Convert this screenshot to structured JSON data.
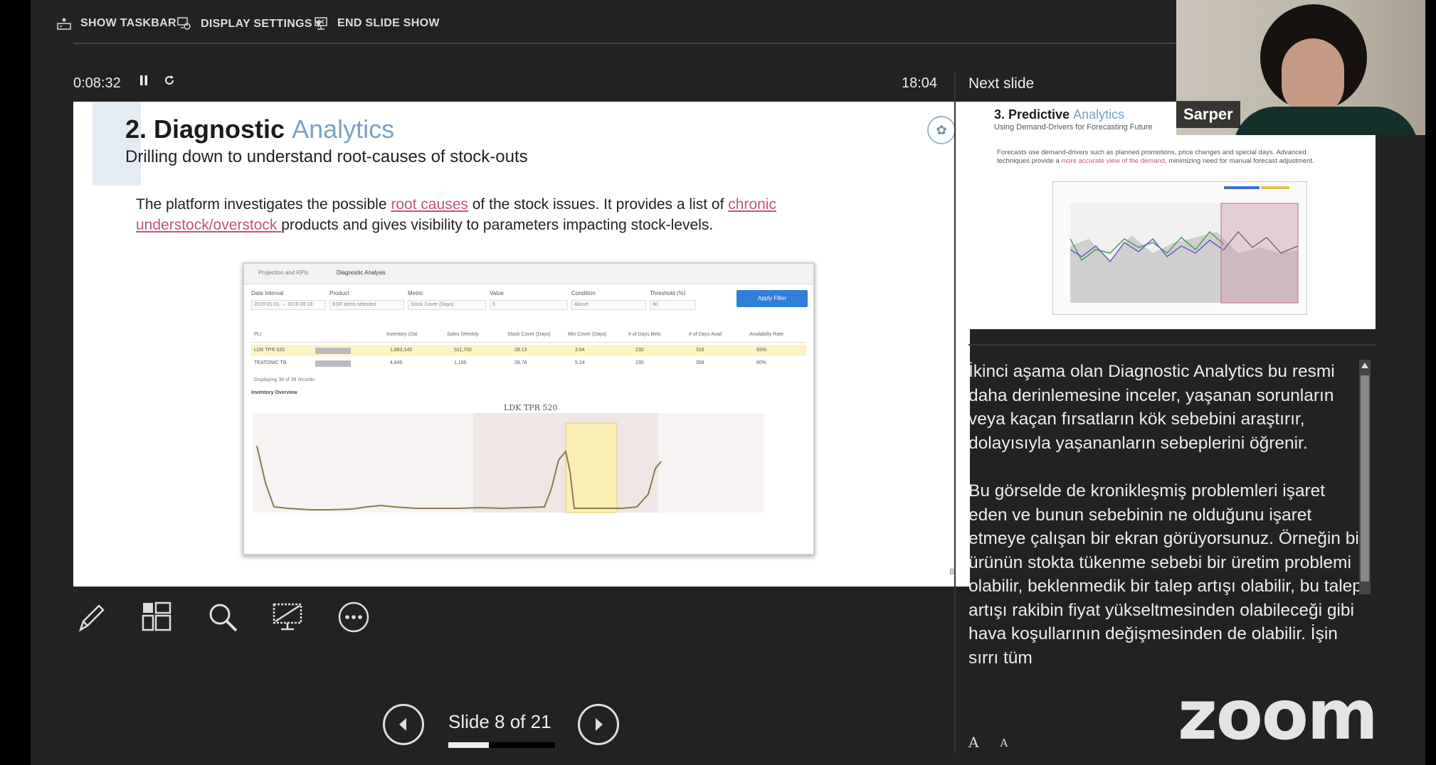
{
  "topbar": {
    "show_taskbar": "SHOW TASKBAR",
    "display_settings": "DISPLAY SETTINGS ▾",
    "end_slide_show": "END SLIDE SHOW"
  },
  "timer": {
    "elapsed": "0:08:32",
    "clock": "18:04"
  },
  "current_slide": {
    "title_main": "2. Diagnostic ",
    "title_highlight": "Analytics",
    "subtitle": "Drilling down to understand root-causes of stock-outs",
    "body_part1": "The platform investigates the possible ",
    "body_link1": "root causes",
    "body_part2": " of the stock issues. It provides a list of ",
    "body_link2": "chronic understock/overstock ",
    "body_part3": "products and gives visibility to parameters impacting stock-levels.",
    "page_number": "8",
    "screenshot": {
      "tab1": "Projection and KPIs",
      "tab2": "Diagnostic Analysis",
      "filter_labels": [
        "Date Interval",
        "Product",
        "Metric",
        "Value",
        "Condition",
        "Threshold (%)"
      ],
      "filter_values": [
        "2019-01-01 → 2019-08-18",
        "EOF items selected",
        "Stock Cover (Days)",
        "5",
        "Above",
        "80"
      ],
      "apply_button": "Apply Filter",
      "columns": [
        "PLI",
        "Inventory (Dai",
        "Sales (Weekly",
        "Stock Cover (Days)",
        "Min Cover (Days)",
        "# of Days Belo",
        "# of Days Avail",
        "Availabilty Rate"
      ],
      "rows": [
        [
          "LDK TPR 520",
          "1,883,145",
          "511,700",
          "28.13",
          "3.84",
          "230",
          "316",
          "93%"
        ],
        [
          "TEATONIC TB",
          "4,845",
          "1,165",
          "28.76",
          "5.24",
          "230",
          "358",
          "60%"
        ]
      ],
      "records_text": "Displaying 38 of 38 records",
      "section_title": "Inventory Overview",
      "chart_title": "LDK TPR 520"
    }
  },
  "next_slide": {
    "label": "Next slide",
    "title_main": "3. Predictive ",
    "title_highlight": "Analytics",
    "subtitle": "Using Demand-Drivers for Forecasting Future",
    "text_part1": "Forecasts use demand-drivers such as planned promotions, price changes and special days. Advanced techniques provide a ",
    "text_link": "more accurate view of the demand",
    "text_part2": ", minimizing need for manual forecast adjustment."
  },
  "notes": {
    "p1": "İkinci aşama olan Diagnostic Analytics bu resmi daha derinlemesine inceler, yaşanan sorunların veya kaçan fırsatların kök sebebini araştırır, dolayısıyla yaşananların sebeplerini öğrenir.",
    "p2": "Bu görselde de kronikleşmiş problemleri işaret eden ve bunun sebebinin ne olduğunu işaret etmeye çalışan bir ekran görüyorsunuz. Örneğin bir ürünün stokta tükenme sebebi bir üretim problemi olabilir, beklenmedik bir talep artışı olabilir, bu talep artışı rakibin fiyat yükseltmesinden olabileceği gibi hava koşullarının değişmesinden de olabilir. İşin sırrı tüm"
  },
  "font_buttons": {
    "increase": "A",
    "decrease": "A"
  },
  "navigation": {
    "slide_label": "Slide 8 of 21",
    "progress": 0.381
  },
  "webcam": {
    "participant_name": "Sarper"
  },
  "watermark": "zoom",
  "icons": [
    "taskbar-icon",
    "display-settings-icon",
    "end-show-icon",
    "pause-icon",
    "reset-icon",
    "pen-icon",
    "see-all-slides-icon",
    "zoom-magnifier-icon",
    "black-screen-icon",
    "more-options-icon",
    "previous-slide-icon",
    "next-slide-icon"
  ]
}
